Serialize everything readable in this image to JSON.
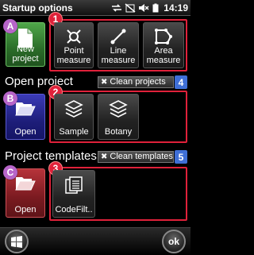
{
  "titlebar": {
    "title": "Startup options",
    "time": "14:19"
  },
  "actions": {
    "badge_a": "A",
    "badge_1": "1",
    "new_project": "New project",
    "point_measure": "Point measure",
    "line_measure": "Line measure",
    "area_measure": "Area measure"
  },
  "open_project": {
    "heading": "Open project",
    "clean_label": "Clean projects",
    "badge_4": "4",
    "badge_b": "B",
    "badge_2": "2",
    "open_label": "Open",
    "items": [
      "Sample",
      "Botany"
    ]
  },
  "templates": {
    "heading": "Project templates",
    "clean_label": "Clean templates",
    "badge_5": "5",
    "badge_c": "C",
    "badge_3": "3",
    "open_label": "Open",
    "items": [
      "CodeFilt.."
    ]
  },
  "bottom": {
    "ok_label": "ok"
  },
  "colors": {
    "frame": "#e0213a",
    "new_tile": "#2b6d29",
    "open_project_tile": "#1e1e7a",
    "open_template_tile": "#7a1a20"
  }
}
